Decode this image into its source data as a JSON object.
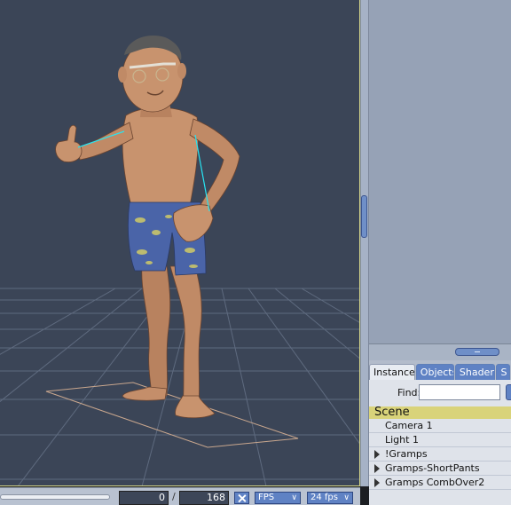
{
  "right_panel": {
    "tabs": [
      {
        "label": "Instances",
        "active": true
      },
      {
        "label": "Objects",
        "active": false
      },
      {
        "label": "Shaders",
        "active": false
      },
      {
        "label": "S",
        "active": false
      }
    ],
    "find_label": "Find:",
    "find_value": "",
    "tree_header": "Scene",
    "tree_items": [
      {
        "label": "Camera 1",
        "expandable": false
      },
      {
        "label": "Light 1",
        "expandable": false
      },
      {
        "label": "!Gramps",
        "expandable": true
      },
      {
        "label": "Gramps-ShortPants",
        "expandable": true
      },
      {
        "label": "Gramps CombOver2",
        "expandable": true
      }
    ]
  },
  "timeline": {
    "current_frame": "0",
    "separator": "/",
    "total_frames": "168",
    "mode_label": "FPS",
    "fps_label": "24 fps"
  },
  "colors": {
    "viewport_bg": "#3b4557",
    "grid": "#6e7b90",
    "scene_header": "#d9d37a",
    "accent_blue": "#5f82c4"
  }
}
